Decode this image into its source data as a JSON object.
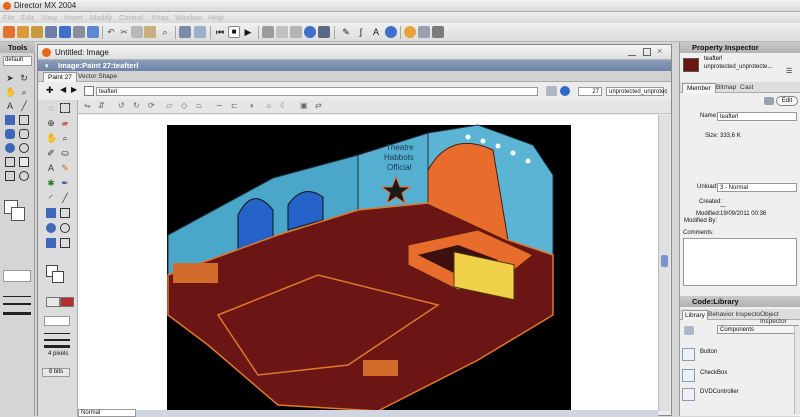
{
  "app": {
    "title": "Director MX 2004",
    "menu": [
      "File",
      "Edit",
      "View",
      "Insert",
      "Modify",
      "Control",
      "Xtras",
      "Window",
      "Help"
    ]
  },
  "tools": {
    "header": "Tools",
    "mode": "default"
  },
  "image_window": {
    "title": "Untitled: Image",
    "subtitle": "Image:Paint 27:teafterl",
    "tabs": [
      "Paint 27",
      "Vector Shape"
    ],
    "member_name": "teafterl",
    "member_number": "27",
    "cast_name": "unprotected_unprotec",
    "zoom": "Normal"
  },
  "paint_tools": {
    "line_label": "4 pixels",
    "bits_label": "8 bits"
  },
  "artwork": {
    "sign_line1": "Theatre",
    "sign_line2": "Habbots",
    "sign_line3": "Official"
  },
  "property_inspector": {
    "header": "Property Inspector",
    "member_name": "teafterl",
    "cast_name": "unprotected_unprotecte...",
    "tabs": [
      "Member",
      "Bitmap",
      "Cast"
    ],
    "edit_label": "Edit",
    "name_label": "Name:",
    "name_value": "teafterl",
    "size_label": "Size: 333,6 K",
    "unload_label": "Unload:",
    "unload_value": "3 - Normal",
    "created_label": "Created:",
    "created_value": "---",
    "modified_label": "Modified:",
    "modified_value": "19/09/2011 00:36",
    "modified_by_label": "Modified By:",
    "comments_label": "Comments:"
  },
  "library": {
    "header": "Code:Library",
    "tabs": [
      "Library",
      "Behavior Inspecto",
      "Object Inspector"
    ],
    "dropdown": "Components",
    "items": [
      "Button",
      "CheckBox",
      "DVDController"
    ]
  }
}
